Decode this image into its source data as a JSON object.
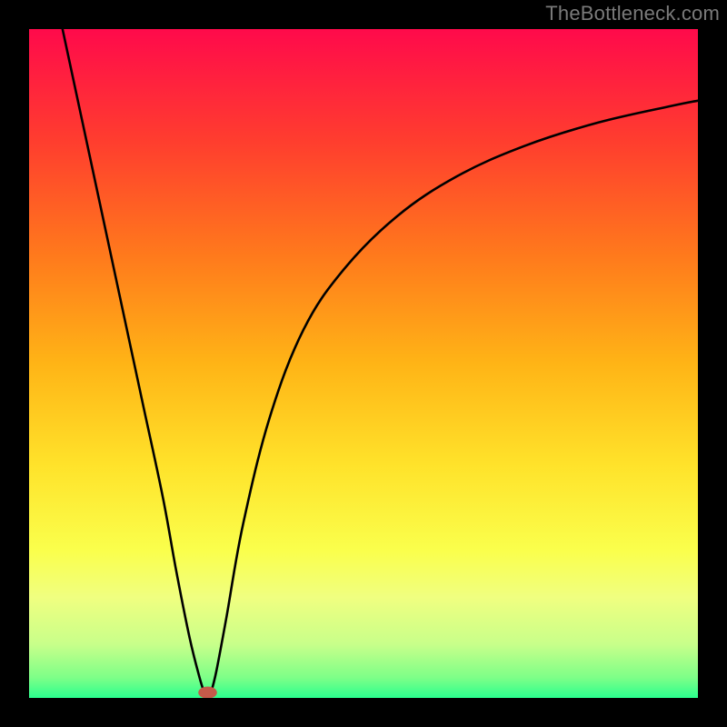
{
  "watermark": "TheBottleneck.com",
  "chart_data": {
    "type": "line",
    "title": "",
    "xlabel": "",
    "ylabel": "",
    "xlim": [
      0,
      100
    ],
    "ylim": [
      0,
      100
    ],
    "grid": false,
    "axes_visible": false,
    "background_gradient": [
      {
        "t": 0.0,
        "color": "#ff0a4b"
      },
      {
        "t": 0.17,
        "color": "#ff3e2e"
      },
      {
        "t": 0.34,
        "color": "#ff7a1c"
      },
      {
        "t": 0.5,
        "color": "#ffb416"
      },
      {
        "t": 0.65,
        "color": "#ffe22a"
      },
      {
        "t": 0.78,
        "color": "#faff4c"
      },
      {
        "t": 0.85,
        "color": "#f0ff80"
      },
      {
        "t": 0.92,
        "color": "#c8ff8a"
      },
      {
        "t": 0.97,
        "color": "#7dff88"
      },
      {
        "t": 1.0,
        "color": "#2bff8e"
      }
    ],
    "series": [
      {
        "name": "left-branch",
        "x": [
          5,
          8,
          11,
          14,
          17,
          20,
          22,
          24,
          25.5,
          26.2
        ],
        "y": [
          100,
          86,
          72,
          58,
          44,
          30,
          19,
          9,
          3,
          0.8
        ]
      },
      {
        "name": "right-branch",
        "x": [
          27.2,
          28,
          29.5,
          32,
          36,
          41,
          47,
          55,
          64,
          74,
          85,
          96,
          100
        ],
        "y": [
          0.8,
          4,
          12,
          26,
          42,
          55,
          64,
          72,
          78,
          82.5,
          86,
          88.5,
          89.3
        ]
      }
    ],
    "marker": {
      "name": "optimal-point",
      "x": 26.7,
      "y": 0.8,
      "rx": 1.4,
      "ry": 0.9,
      "color": "#c45a4a"
    }
  }
}
